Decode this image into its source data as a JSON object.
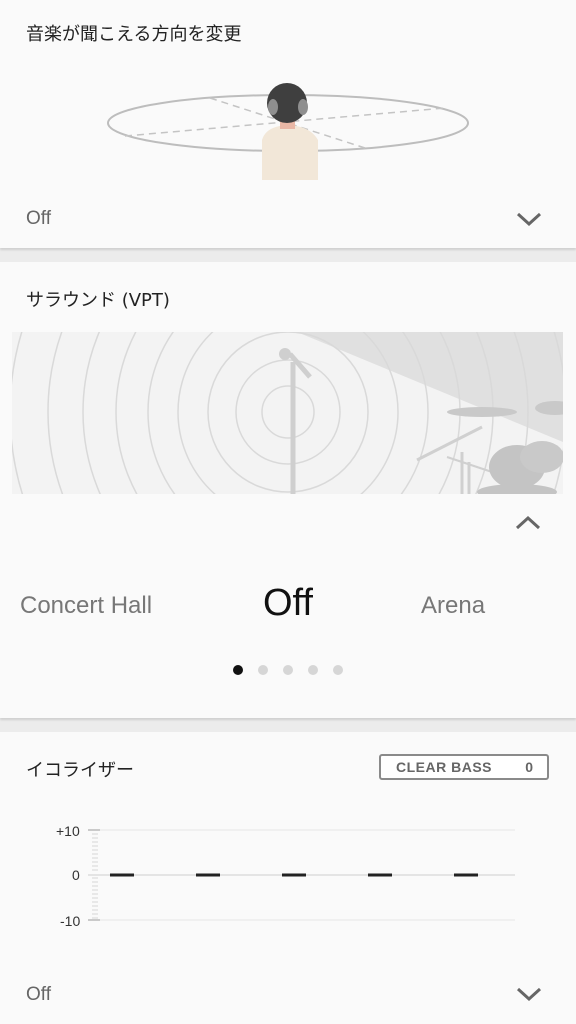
{
  "direction": {
    "title": "音楽が聞こえる方向を変更",
    "value": "Off",
    "expand_icon": "chevron-down-icon"
  },
  "surround": {
    "title": "サラウンド (VPT)",
    "collapse_icon": "chevron-up-icon",
    "carousel": {
      "prev": "Concert Hall",
      "current": "Off",
      "next": "Arena",
      "page_count": 5,
      "active_page": 1
    }
  },
  "equalizer": {
    "title": "イコライザー",
    "clear_bass": {
      "label": "CLEAR BASS",
      "value": "0"
    },
    "scale": {
      "max": "+10",
      "zero": "0",
      "min": "-10"
    },
    "bands": [
      0,
      0,
      0,
      0,
      0
    ],
    "value": "Off",
    "expand_icon": "chevron-down-icon"
  }
}
